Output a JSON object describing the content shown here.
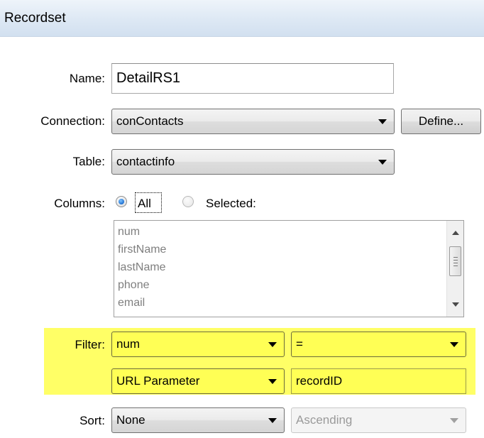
{
  "window": {
    "title": "Recordset"
  },
  "name": {
    "label": "Name:",
    "value": "DetailRS1"
  },
  "connection": {
    "label": "Connection:",
    "value": "conContacts",
    "define_label": "Define..."
  },
  "table": {
    "label": "Table:",
    "value": "contactinfo"
  },
  "columns": {
    "label": "Columns:",
    "options": {
      "all": "All",
      "selected": "Selected:"
    },
    "selected_option": "All",
    "items": [
      "num",
      "firstName",
      "lastName",
      "phone",
      "email"
    ]
  },
  "filter": {
    "label": "Filter:",
    "column": "num",
    "operator": "=",
    "source": "URL Parameter",
    "value": "recordID"
  },
  "sort": {
    "label": "Sort:",
    "column": "None",
    "order": "Ascending"
  },
  "colors": {
    "highlight": "#ffff66",
    "radio_accent": "#1e6fd1"
  }
}
